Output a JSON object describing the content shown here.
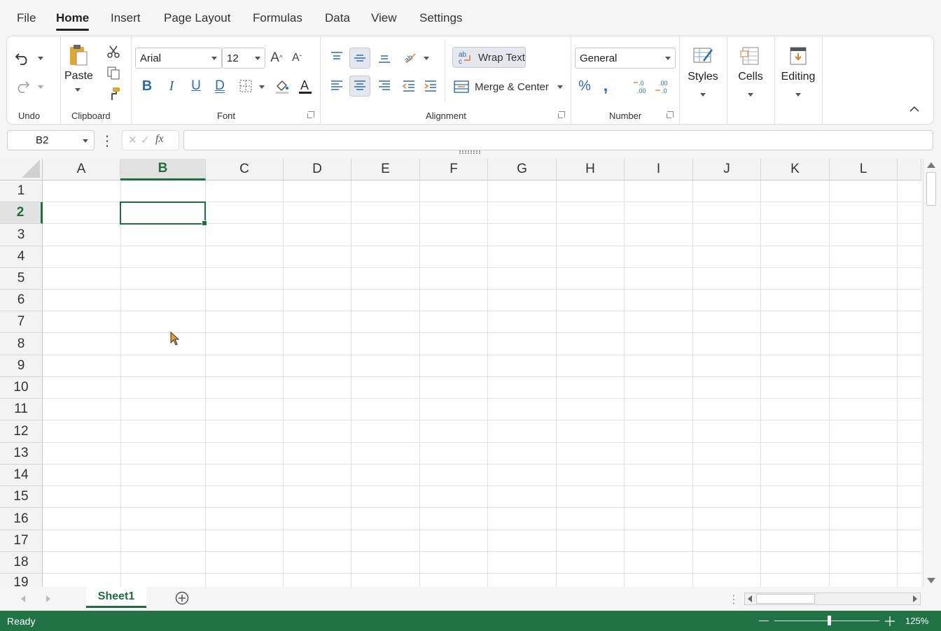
{
  "menu": {
    "tabs": [
      "File",
      "Home",
      "Insert",
      "Page Layout",
      "Formulas",
      "Data",
      "View",
      "Settings"
    ],
    "active": "Home"
  },
  "ribbon": {
    "groups": {
      "undo": "Undo",
      "clipboard": "Clipboard",
      "font": "Font",
      "alignment": "Alignment",
      "number": "Number"
    },
    "paste_label": "Paste",
    "font_name": "Arial",
    "font_size": "12",
    "wrap_text_label": "Wrap Text",
    "merge_center_label": "Merge & Center",
    "number_format": "General",
    "styles_label": "Styles",
    "cells_label": "Cells",
    "editing_label": "Editing",
    "accent_color": "#217346"
  },
  "formula_bar": {
    "name_box": "B2",
    "fx_label": "fx",
    "formula": ""
  },
  "grid": {
    "columns": [
      "A",
      "B",
      "C",
      "D",
      "E",
      "F",
      "G",
      "H",
      "I",
      "J",
      "K",
      "L"
    ],
    "rows": [
      "1",
      "2",
      "3",
      "4",
      "5",
      "6",
      "7",
      "8",
      "9",
      "10",
      "11",
      "12",
      "13",
      "14",
      "15",
      "16",
      "17",
      "18",
      "19"
    ],
    "selected_column": "B",
    "selected_row": "2"
  },
  "sheets": {
    "tabs": [
      "Sheet1"
    ],
    "active": "Sheet1"
  },
  "status": {
    "text": "Ready",
    "zoom": "125%"
  }
}
